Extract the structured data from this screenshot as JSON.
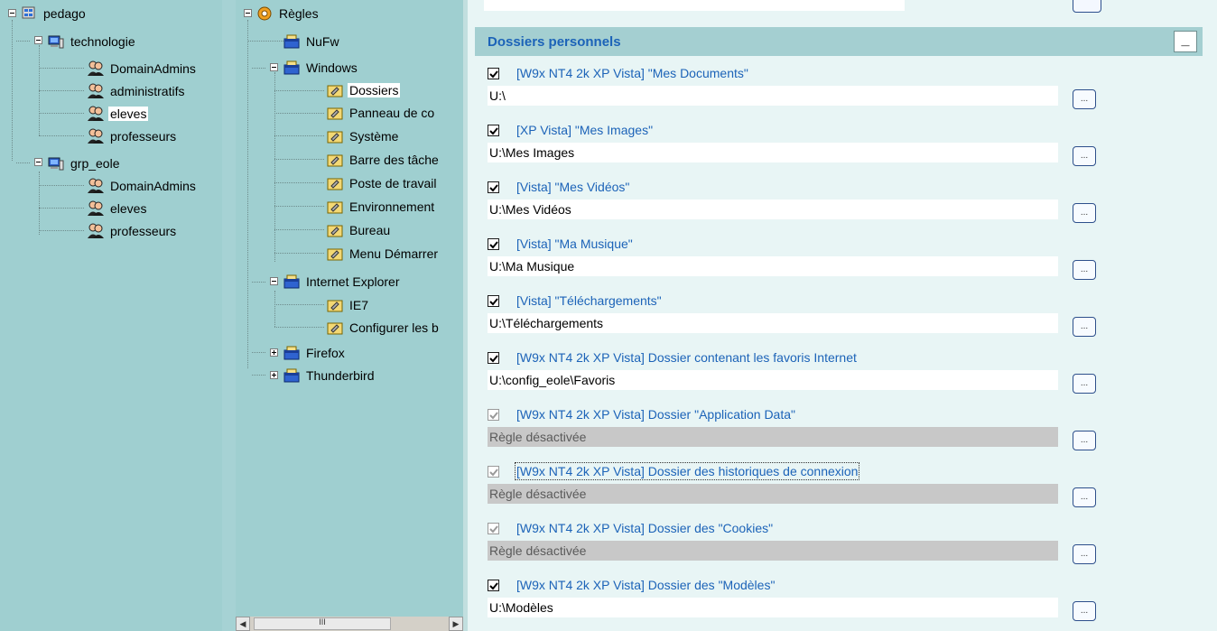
{
  "groups_tree": {
    "root": "pedago",
    "nodes": [
      {
        "label": "technologie",
        "children": [
          "DomainAdmins",
          "administratifs",
          "eleves",
          "professeurs"
        ]
      },
      {
        "label": "grp_eole",
        "children": [
          "DomainAdmins",
          "eleves",
          "professeurs"
        ]
      }
    ],
    "selected": "eleves"
  },
  "rules_tree": {
    "root": "Règles",
    "nufw": "NuFw",
    "windows": "Windows",
    "windows_children": [
      "Dossiers",
      "Panneau de co",
      "Système",
      "Barre des tâche",
      "Poste de travail",
      "Environnement",
      "Bureau",
      "Menu Démarrer"
    ],
    "ie": "Internet Explorer",
    "ie_children": [
      "IE7",
      "Configurer les b"
    ],
    "firefox": "Firefox",
    "thunderbird": "Thunderbird",
    "selected": "Dossiers",
    "scroll_grip": "III"
  },
  "section": {
    "title": "Dossiers personnels",
    "collapse": "_",
    "browse": "..."
  },
  "rules": [
    {
      "label": "[W9x NT4 2k XP Vista] \"Mes Documents\"",
      "value": "U:\\",
      "enabled": true
    },
    {
      "label": "[XP Vista] \"Mes Images\"",
      "value": "U:\\Mes Images",
      "enabled": true
    },
    {
      "label": "[Vista] \"Mes Vidéos\"",
      "value": "U:\\Mes Vidéos",
      "enabled": true
    },
    {
      "label": "[Vista] \"Ma Musique\"",
      "value": "U:\\Ma Musique",
      "enabled": true
    },
    {
      "label": "[Vista] \"Téléchargements\"",
      "value": "U:\\Téléchargements",
      "enabled": true
    },
    {
      "label": "[W9x NT4 2k XP Vista] Dossier contenant les favoris Internet",
      "value": "U:\\config_eole\\Favoris",
      "enabled": true
    },
    {
      "label": "[W9x NT4 2k XP Vista] Dossier \"Application Data\"",
      "value": "Règle désactivée",
      "enabled": false
    },
    {
      "label": "[W9x NT4 2k XP Vista] Dossier des historiques de connexion",
      "value": "Règle désactivée",
      "enabled": false
    },
    {
      "label": "[W9x NT4 2k XP Vista] Dossier des \"Cookies\"",
      "value": "Règle désactivée",
      "enabled": false
    },
    {
      "label": "[W9x NT4 2k XP Vista] Dossier des \"Modèles\"",
      "value": "U:\\Modèles",
      "enabled": true
    }
  ]
}
